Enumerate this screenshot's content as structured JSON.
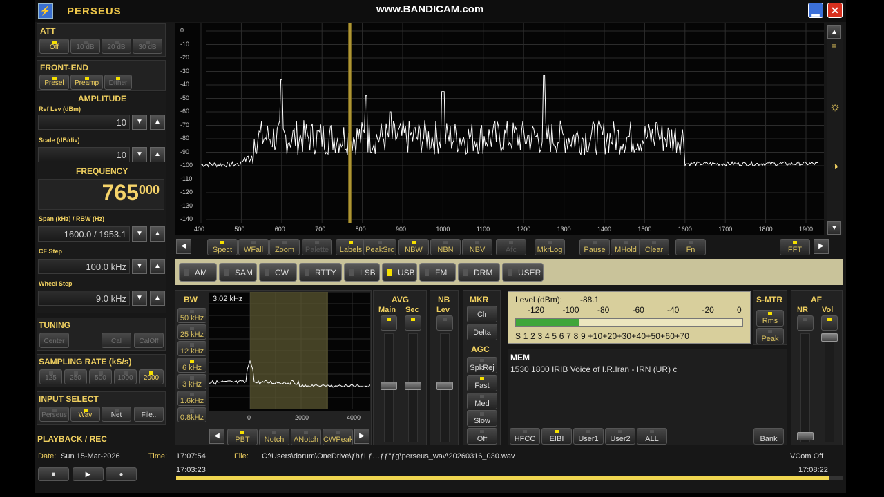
{
  "watermark": "www.BANDICAM.com",
  "app": {
    "title": "PERSEUS",
    "logo": "⚡"
  },
  "att": {
    "title": "ATT",
    "buttons": [
      "Off",
      "10 dB",
      "20 dB",
      "30 dB"
    ]
  },
  "frontend": {
    "title": "FRONT-END",
    "buttons": [
      "Presel",
      "Preamp",
      "Dither"
    ]
  },
  "amplitude": {
    "title": "AMPLITUDE",
    "ref_label": "Ref Lev (dBm)",
    "ref_value": "10",
    "scale_label": "Scale (dB/div)",
    "scale_value": "10"
  },
  "frequency": {
    "title": "FREQUENCY",
    "main": "765",
    "sub": "000",
    "span_label": "Span (kHz) / RBW (Hz)",
    "span_value": "1600.0 / 1953.1",
    "cf_label": "CF Step",
    "cf_value": "100.0 kHz",
    "wheel_label": "Wheel Step",
    "wheel_value": "9.0 kHz"
  },
  "tuning": {
    "title": "TUNING",
    "buttons": [
      "Center",
      "Cal",
      "CalOff"
    ]
  },
  "sampling": {
    "title": "SAMPLING RATE (kS/s)",
    "buttons": [
      "125",
      "250",
      "500",
      "1000",
      "2000"
    ]
  },
  "input": {
    "title": "INPUT SELECT",
    "buttons": [
      "Perseus",
      "Wav",
      "Net",
      "File.."
    ]
  },
  "playback_title": "PLAYBACK / REC",
  "spectrum": {
    "y_ticks": [
      "0",
      "-10",
      "-20",
      "-30",
      "-40",
      "-50",
      "-60",
      "-70",
      "-80",
      "-90",
      "-100",
      "-110",
      "-120",
      "-130",
      "-140"
    ],
    "x_ticks": [
      "400",
      "500",
      "600",
      "700",
      "800",
      "900",
      "1000",
      "1100",
      "1200",
      "1300",
      "1400",
      "1500",
      "1600",
      "1700",
      "1800",
      "1900"
    ]
  },
  "toolbar": {
    "buttons": [
      "Spect",
      "WFall",
      "Zoom",
      "Palette",
      "Labels",
      "PeakSrc",
      "NBW",
      "NBN",
      "NBV",
      "Afc",
      "MkrLog",
      "Pause",
      "MHold",
      "Clear",
      "Fn",
      "FFT"
    ]
  },
  "modes": [
    "AM",
    "SAM",
    "CW",
    "RTTY",
    "LSB",
    "USB",
    "FM",
    "DRM",
    "USER"
  ],
  "bw": {
    "title": "BW",
    "value": "3.02 kHz",
    "buttons": [
      "50 kHz",
      "25 kHz",
      "12 kHz",
      "6 kHz",
      "3 kHz",
      "1.6kHz",
      "0.8kHz"
    ],
    "x_ticks": [
      "0",
      "2000",
      "4000"
    ],
    "bottom": [
      "PBT",
      "Notch",
      "ANotch",
      "CWPeak"
    ]
  },
  "avg": {
    "title": "AVG",
    "main": "Main",
    "sec": "Sec"
  },
  "nb": {
    "title": "NB",
    "lev": "Lev"
  },
  "mkr": {
    "title": "MKR",
    "buttons": [
      "Clr",
      "Delta"
    ]
  },
  "agc": {
    "title": "AGC",
    "buttons": [
      "SpkRej",
      "Fast",
      "Med",
      "Slow",
      "Off"
    ]
  },
  "meter": {
    "level_label": "Level (dBm):",
    "level_value": "-88.1",
    "dbm_ticks": [
      "-120",
      "-100",
      "-80",
      "-60",
      "-40",
      "-20",
      "0"
    ],
    "s_scale": "S 1 2 3 4 5 6 7 8 9 +10+20+30+40+50+60+70",
    "fill": 0.28
  },
  "smtr": {
    "title": "S-MTR",
    "buttons": [
      "Rms",
      "Peak"
    ]
  },
  "af": {
    "title": "AF",
    "nr": "NR",
    "vol": "Vol"
  },
  "mem": {
    "title": "MEM",
    "entry": "1530 1800 IRIB Voice of I.R.Iran  - IRN (UR)   c",
    "buttons": [
      "HFCC",
      "EIBI",
      "User1",
      "User2",
      "ALL"
    ],
    "bank": "Bank"
  },
  "status": {
    "date_label": "Date:",
    "date_value": "Sun 15-Mar-2026",
    "time_label": "Time:",
    "time_value": "17:07:54",
    "file_label": "File:",
    "file_value": "C:\\Users\\dorum\\OneDrive\\ƒhƒLƒ…ƒƒ\"ƒg\\perseus_wav\\20260316_030.wav",
    "vcom": "VCom Off",
    "start": "17:03:23",
    "end": "17:08:22",
    "progress": 0.98
  }
}
